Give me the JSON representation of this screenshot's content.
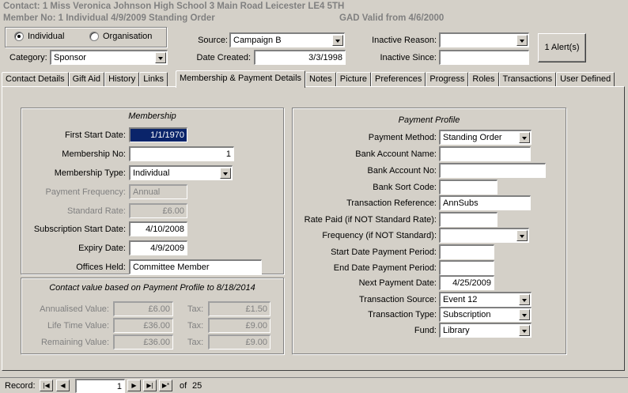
{
  "header": {
    "contact_line": "Contact: 1 Miss Veronica Johnson High School 3 Main Road Leicester  LE4 5TH",
    "member_line": "Member No: 1 Individual 4/9/2009 Standing Order",
    "gad_line": "GAD Valid from 4/6/2000"
  },
  "type_group": {
    "individual_label": "Individual",
    "organisation_label": "Organisation",
    "selected": "Individual"
  },
  "category": {
    "label": "Category:",
    "value": "Sponsor"
  },
  "source": {
    "label": "Source:",
    "value": "Campaign B"
  },
  "date_created": {
    "label": "Date Created:",
    "value": "3/3/1998"
  },
  "inactive_reason": {
    "label": "Inactive Reason:",
    "value": ""
  },
  "inactive_since": {
    "label": "Inactive Since:",
    "value": ""
  },
  "alert_button": {
    "label": "1 Alert(s)"
  },
  "tabs": [
    {
      "label": "Contact Details"
    },
    {
      "label": "Gift Aid"
    },
    {
      "label": "History"
    },
    {
      "label": "Links"
    },
    {
      "label": "Membership & Payment Details"
    },
    {
      "label": "Notes"
    },
    {
      "label": "Picture"
    },
    {
      "label": "Preferences"
    },
    {
      "label": "Progress"
    },
    {
      "label": "Roles"
    },
    {
      "label": "Transactions"
    },
    {
      "label": "User Defined"
    }
  ],
  "active_tab": "Membership & Payment Details",
  "membership": {
    "title": "Membership",
    "first_start_date": {
      "label": "First Start Date:",
      "value": "1/1/1970"
    },
    "membership_no": {
      "label": "Membership No:",
      "value": "1"
    },
    "membership_type": {
      "label": "Membership Type:",
      "value": "Individual"
    },
    "payment_frequency": {
      "label": "Payment Frequency:",
      "value": "Annual"
    },
    "standard_rate": {
      "label": "Standard Rate:",
      "value": "£6.00"
    },
    "subscription_start_date": {
      "label": "Subscription Start Date:",
      "value": "4/10/2008"
    },
    "expiry_date": {
      "label": "Expiry Date:",
      "value": "4/9/2009"
    },
    "offices_held": {
      "label": "Offices Held:",
      "value": "Committee Member"
    }
  },
  "contact_value": {
    "title": "Contact value based on Payment Profile to 8/18/2014",
    "annualised": {
      "label": "Annualised Value:",
      "value": "£6.00",
      "tax": "£1.50"
    },
    "life_time": {
      "label": "Life Time Value:",
      "value": "£36.00",
      "tax": "£9.00"
    },
    "remaining": {
      "label": "Remaining Value:",
      "value": "£36.00",
      "tax": "£9.00"
    },
    "tax_label": "Tax:"
  },
  "payment_profile": {
    "title": "Payment Profile",
    "payment_method": {
      "label": "Payment Method:",
      "value": "Standing Order"
    },
    "bank_account_name": {
      "label": "Bank Account Name:",
      "value": ""
    },
    "bank_account_no": {
      "label": "Bank Account No:",
      "value": ""
    },
    "bank_sort_code": {
      "label": "Bank Sort Code:",
      "value": ""
    },
    "transaction_reference": {
      "label": "Transaction Reference:",
      "value": "AnnSubs"
    },
    "rate_paid": {
      "label": "Rate Paid (if NOT Standard Rate):",
      "value": ""
    },
    "frequency": {
      "label": "Frequency (if NOT Standard):",
      "value": ""
    },
    "start_date_payment_period": {
      "label": "Start Date Payment Period:",
      "value": ""
    },
    "end_date_payment_period": {
      "label": "End Date Payment Period:",
      "value": ""
    },
    "next_payment_date": {
      "label": "Next Payment Date:",
      "value": "4/25/2009"
    },
    "transaction_source": {
      "label": "Transaction Source:",
      "value": "Event 12"
    },
    "transaction_type": {
      "label": "Transaction Type:",
      "value": "Subscription"
    },
    "fund": {
      "label": "Fund:",
      "value": "Library"
    }
  },
  "record_nav": {
    "label": "Record:",
    "current": "1",
    "of_label": "of",
    "total": "25"
  }
}
